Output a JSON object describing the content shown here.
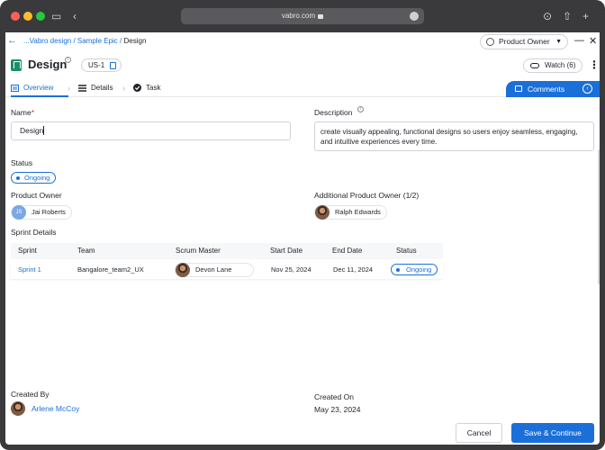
{
  "browser": {
    "url": "vabro.com"
  },
  "breadcrumb": {
    "parts": [
      "...Vabro design",
      "Sample Epic"
    ],
    "current": "Design"
  },
  "header": {
    "role_select": "Product Owner",
    "title": "Design",
    "item_id": "US-1",
    "watch_label": "Watch (6)"
  },
  "tabs": [
    {
      "label": "Overview"
    },
    {
      "label": "Details"
    },
    {
      "label": "Task"
    }
  ],
  "comments": {
    "label": "Comments"
  },
  "form": {
    "name_label": "Name",
    "name_required": "*",
    "name_value": "Design",
    "description_label": "Description",
    "description_value": "create visually appealing, functional designs so users enjoy seamless, engaging, and intuitive experiences every time.",
    "status_label": "Status",
    "status_value": "Ongoing",
    "product_owner_label": "Product Owner",
    "product_owner": {
      "initials": "JS",
      "name": "Jai Roberts"
    },
    "additional_owner_label": "Additional Product Owner (1/2)",
    "additional_owner": {
      "name": "Ralph Edwards"
    }
  },
  "sprint_details": {
    "title": "Sprint Details",
    "columns": [
      "Sprint",
      "Team",
      "Scrum Master",
      "Start Date",
      "End Date",
      "Status"
    ],
    "rows": [
      {
        "sprint": "Sprint 1",
        "team": "Bangalore_team2_UX",
        "scrum_master": "Devon Lane",
        "start": "Nov 25, 2024",
        "end": "Dec 11, 2024",
        "status": "Ongoing"
      }
    ]
  },
  "footer": {
    "created_by_label": "Created By",
    "created_by": "Arlene McCoy",
    "created_on_label": "Created On",
    "created_on": "May 23, 2024",
    "cancel_label": "Cancel",
    "save_label": "Save & Continue"
  },
  "colors": {
    "accent": "#1a6fd9",
    "brand_icon": "#1a8f6a",
    "required": "#d92d20"
  }
}
